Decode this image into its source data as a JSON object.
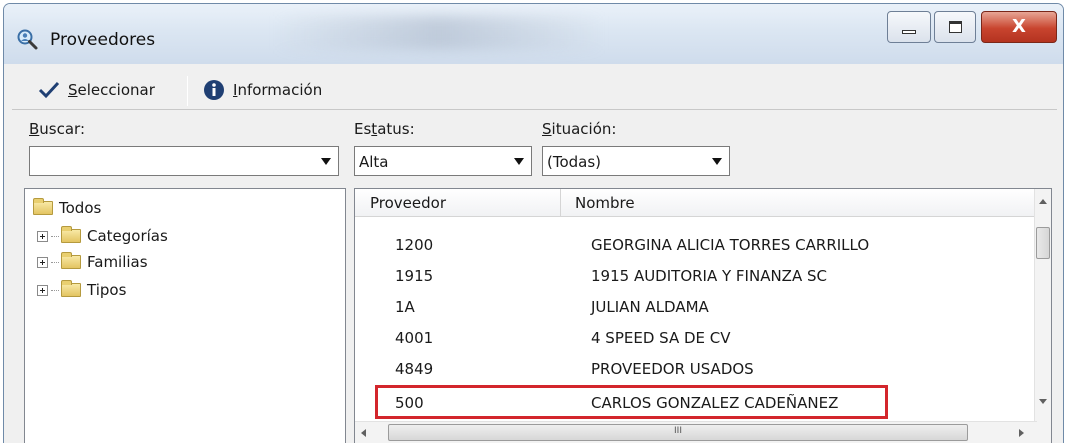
{
  "window": {
    "title": "Proveedores",
    "icon": "search-people-icon",
    "controls": {
      "minimize": "minimize-icon",
      "maximize": "maximize-icon",
      "close": "X"
    }
  },
  "toolbar": {
    "select_label_u": "S",
    "select_label_rest": "eleccionar",
    "info_label_u": "I",
    "info_label_rest": "nformación"
  },
  "filters": {
    "search_label_u": "B",
    "search_label_rest": "uscar:",
    "search_value": "",
    "status_label_pre": "Es",
    "status_label_u": "t",
    "status_label_rest": "atus:",
    "status_value": "Alta",
    "situation_label_u": "S",
    "situation_label_rest": "ituación:",
    "situation_value": "(Todas)"
  },
  "tree": {
    "root": "Todos",
    "children": [
      "Categorías",
      "Familias",
      "Tipos"
    ]
  },
  "list": {
    "columns": [
      "Proveedor",
      "Nombre"
    ],
    "rows": [
      {
        "id": "1200",
        "name": "GEORGINA ALICIA TORRES CARRILLO"
      },
      {
        "id": "1915",
        "name": "1915 AUDITORIA Y FINANZA SC"
      },
      {
        "id": "1A",
        "name": "JULIAN ALDAMA"
      },
      {
        "id": "4001",
        "name": "4 SPEED SA DE CV"
      },
      {
        "id": "4849",
        "name": "PROVEEDOR USADOS"
      },
      {
        "id": "500",
        "name": "CARLOS GONZALEZ CADEÑANEZ"
      }
    ],
    "highlighted_row": "500",
    "highlight_color": "#d3262c"
  },
  "scroll": {
    "hthumb_grip": "III"
  }
}
